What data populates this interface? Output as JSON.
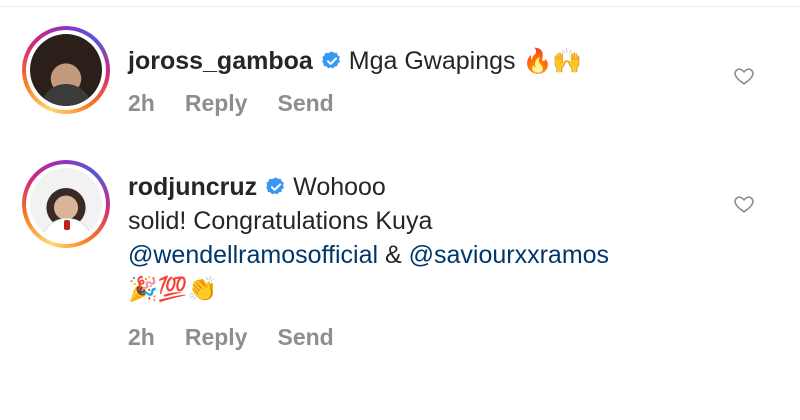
{
  "comments": [
    {
      "username": "joross_gamboa",
      "verified": true,
      "text": "Mga Gwapings",
      "emojis": "🔥🙌",
      "time": "2h",
      "reply_label": "Reply",
      "send_label": "Send"
    },
    {
      "username": "rodjuncruz",
      "verified": true,
      "text_line1": "Wohooo",
      "text_line2": "solid! Congratulations Kuya",
      "mention1": "@wendellramosofficial",
      "amp": "&",
      "mention2": "@saviourxxramos",
      "emojis": "🎉💯👏",
      "time": "2h",
      "reply_label": "Reply",
      "send_label": "Send"
    }
  ],
  "icons": {
    "verified": "verified-badge-icon",
    "like": "heart-icon"
  },
  "colors": {
    "text": "#262626",
    "meta": "#8e8e8e",
    "mention": "#00376b",
    "verified": "#3897f0"
  }
}
